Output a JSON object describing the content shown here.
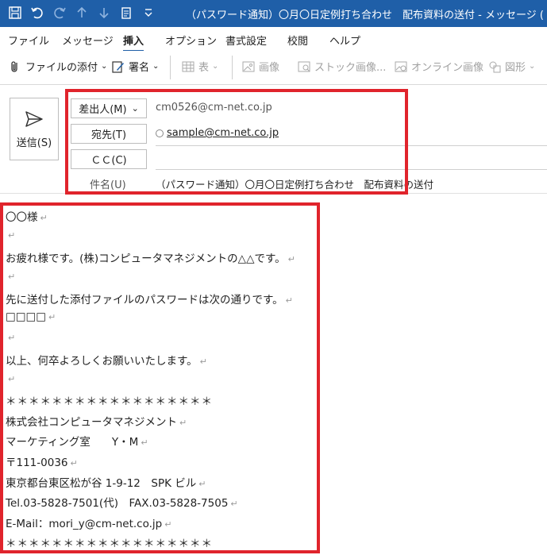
{
  "window": {
    "title": "（パスワード通知）〇月〇日定例打ち合わせ　配布資料の送付  -  メッセージ (テキスト..."
  },
  "menu": {
    "items": [
      "ファイル",
      "メッセージ",
      "挿入",
      "オプション",
      "書式設定",
      "校閲",
      "ヘルプ"
    ]
  },
  "ribbon": {
    "attach": "ファイルの添付",
    "signature": "署名",
    "table": "表",
    "picture": "画像",
    "stock": "ストック画像...",
    "online": "オンライン画像",
    "shapes": "図形"
  },
  "compose": {
    "send": "送信(S)",
    "from_label": "差出人(M)",
    "from_value": "cm0526@cm-net.co.jp",
    "to_label": "宛先(T)",
    "to_value": "sample@cm-net.co.jp",
    "cc_label": "ＣＣ(C)",
    "subject_label": "件名(U)",
    "subject_value": "（パスワード通知）〇月〇日定例打ち合わせ　配布資料の送付"
  },
  "body": {
    "lines": [
      "〇〇様",
      "",
      "お疲れ様です。(株)コンピュータマネジメントの△△です。",
      "",
      "先に送付した添付ファイルのパスワードは次の通りです。",
      "□□□□",
      "",
      "以上、何卒よろしくお願いいたします。",
      "",
      "＊＊＊＊＊＊＊＊＊＊＊＊＊＊＊＊＊＊",
      "株式会社コンピュータマネジメント",
      "マーケティング室　　Y・M",
      "〒111-0036",
      "東京都台東区松が谷 1-9-12　SPK ビル",
      "Tel.03-5828-7501(代)　FAX.03-5828-7505",
      "E-Mail：mori_y@cm-net.co.jp",
      "＊＊＊＊＊＊＊＊＊＊＊＊＊＊＊＊＊＊"
    ],
    "return_mark": "↵"
  },
  "colors": {
    "titlebar": "#1f5fa8",
    "highlight": "#e0242c"
  }
}
